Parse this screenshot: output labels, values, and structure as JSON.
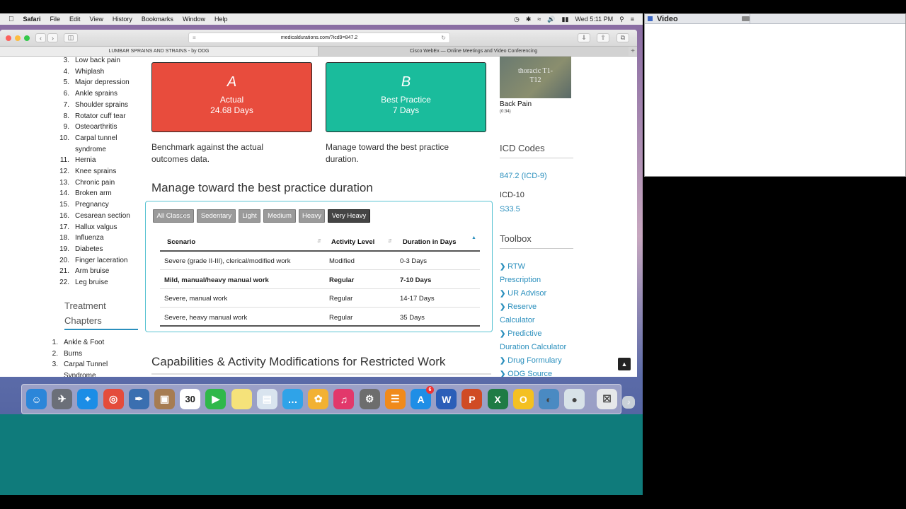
{
  "menubar": {
    "apple": "",
    "app": "Safari",
    "items": [
      "File",
      "Edit",
      "View",
      "History",
      "Bookmarks",
      "Window",
      "Help"
    ],
    "clock": "Wed 5:11 PM"
  },
  "video_panel": {
    "title": "Video"
  },
  "browser": {
    "url": "medicaldurations.com/?icd9=847.2",
    "tabs": [
      "LUMBAR SPRAINS AND STRAINS - by ODG",
      "Cisco WebEx — Online Meetings and Video Conferencing"
    ],
    "tab_plus": "+"
  },
  "left_list": [
    {
      "n": "3.",
      "t": "Low back pain"
    },
    {
      "n": "4.",
      "t": "Whiplash"
    },
    {
      "n": "5.",
      "t": "Major depression"
    },
    {
      "n": "6.",
      "t": "Ankle sprains"
    },
    {
      "n": "7.",
      "t": "Shoulder sprains"
    },
    {
      "n": "8.",
      "t": "Rotator cuff tear"
    },
    {
      "n": "9.",
      "t": "Osteoarthritis"
    },
    {
      "n": "10.",
      "t": "Carpal tunnel syndrome"
    },
    {
      "n": "11.",
      "t": "Hernia"
    },
    {
      "n": "12.",
      "t": "Knee sprains"
    },
    {
      "n": "13.",
      "t": "Chronic pain"
    },
    {
      "n": "14.",
      "t": "Broken arm"
    },
    {
      "n": "15.",
      "t": "Pregnancy"
    },
    {
      "n": "16.",
      "t": "Cesarean section"
    },
    {
      "n": "17.",
      "t": "Hallux valgus"
    },
    {
      "n": "18.",
      "t": "Influenza"
    },
    {
      "n": "19.",
      "t": "Diabetes"
    },
    {
      "n": "20.",
      "t": "Finger laceration"
    },
    {
      "n": "21.",
      "t": "Arm bruise"
    },
    {
      "n": "22.",
      "t": "Leg bruise"
    }
  ],
  "treatment": {
    "heading": "Treatment Chapters",
    "items": [
      {
        "n": "1.",
        "t": "Ankle & Foot"
      },
      {
        "n": "2.",
        "t": "Burns"
      },
      {
        "n": "3.",
        "t": "Carpal Tunnel Syndrome"
      }
    ]
  },
  "cards": {
    "a": {
      "letter": "A",
      "label": "Actual",
      "value": "24.68 Days",
      "color": "#e84c3d",
      "desc": "Benchmark against the actual outcomes data."
    },
    "b": {
      "letter": "B",
      "label": "Best Practice",
      "value": "7 Days",
      "color": "#1abc9c",
      "desc": "Manage toward the best practice duration."
    }
  },
  "manage_heading": "Manage toward the best practice duration",
  "filters": [
    "All Classes",
    "Sedentary",
    "Light",
    "Medium",
    "Heavy",
    "Very Heavy"
  ],
  "active_filter": "Very Heavy",
  "table": {
    "headers": [
      "Scenario",
      "Activity Level",
      "Duration in Days"
    ],
    "rows": [
      {
        "scenario": "Severe (grade II-III), clerical/modified work",
        "level": "Modified",
        "duration": "0-3 Days",
        "bold": false
      },
      {
        "scenario": "Mild, manual/heavy manual work",
        "level": "Regular",
        "duration": "7-10 Days",
        "bold": true
      },
      {
        "scenario": "Severe, manual work",
        "level": "Regular",
        "duration": "14-17 Days",
        "bold": false
      },
      {
        "scenario": "Severe, heavy manual work",
        "level": "Regular",
        "duration": "35 Days",
        "bold": false
      }
    ]
  },
  "capabilities_heading": "Capabilities & Activity Modifications for Restricted Work",
  "right": {
    "video_thumb_text": "thoracic T1-T12",
    "video_title": "Back Pain",
    "video_time": "(0:34)",
    "icd_heading": "ICD Codes",
    "icd9": "847.2 (ICD-9)",
    "icd10_label": "ICD-10",
    "icd10_code": "S33.5",
    "toolbox_heading": "Toolbox",
    "toolbox": [
      {
        "line1": "RTW",
        "line2": "Prescription"
      },
      {
        "line1": "UR Advisor",
        "line2": ""
      },
      {
        "line1": "Reserve",
        "line2": "Calculator"
      },
      {
        "line1": "Predictive",
        "line2": "Duration Calculator"
      },
      {
        "line1": "Drug Formulary",
        "line2": ""
      },
      {
        "line1": "ODG Source",
        "line2": ""
      }
    ]
  },
  "dock": {
    "icons": [
      "finder-icon",
      "launchpad-icon",
      "safari-icon",
      "chrome-icon",
      "preview-icon",
      "contacts-icon",
      "calendar-icon",
      "facetime-icon",
      "notes-icon",
      "photo-icon",
      "messages-icon",
      "photos-icon",
      "itunes-icon",
      "system-preferences-icon",
      "ibooks-icon",
      "app-store-icon",
      "word-icon",
      "powerpoint-icon",
      "excel-icon",
      "outlook-icon",
      "webex-icon",
      "globe-icon",
      "itunes-small-icon",
      "trash-icon"
    ],
    "calendar_day": "30",
    "appstore_badge": "6"
  }
}
